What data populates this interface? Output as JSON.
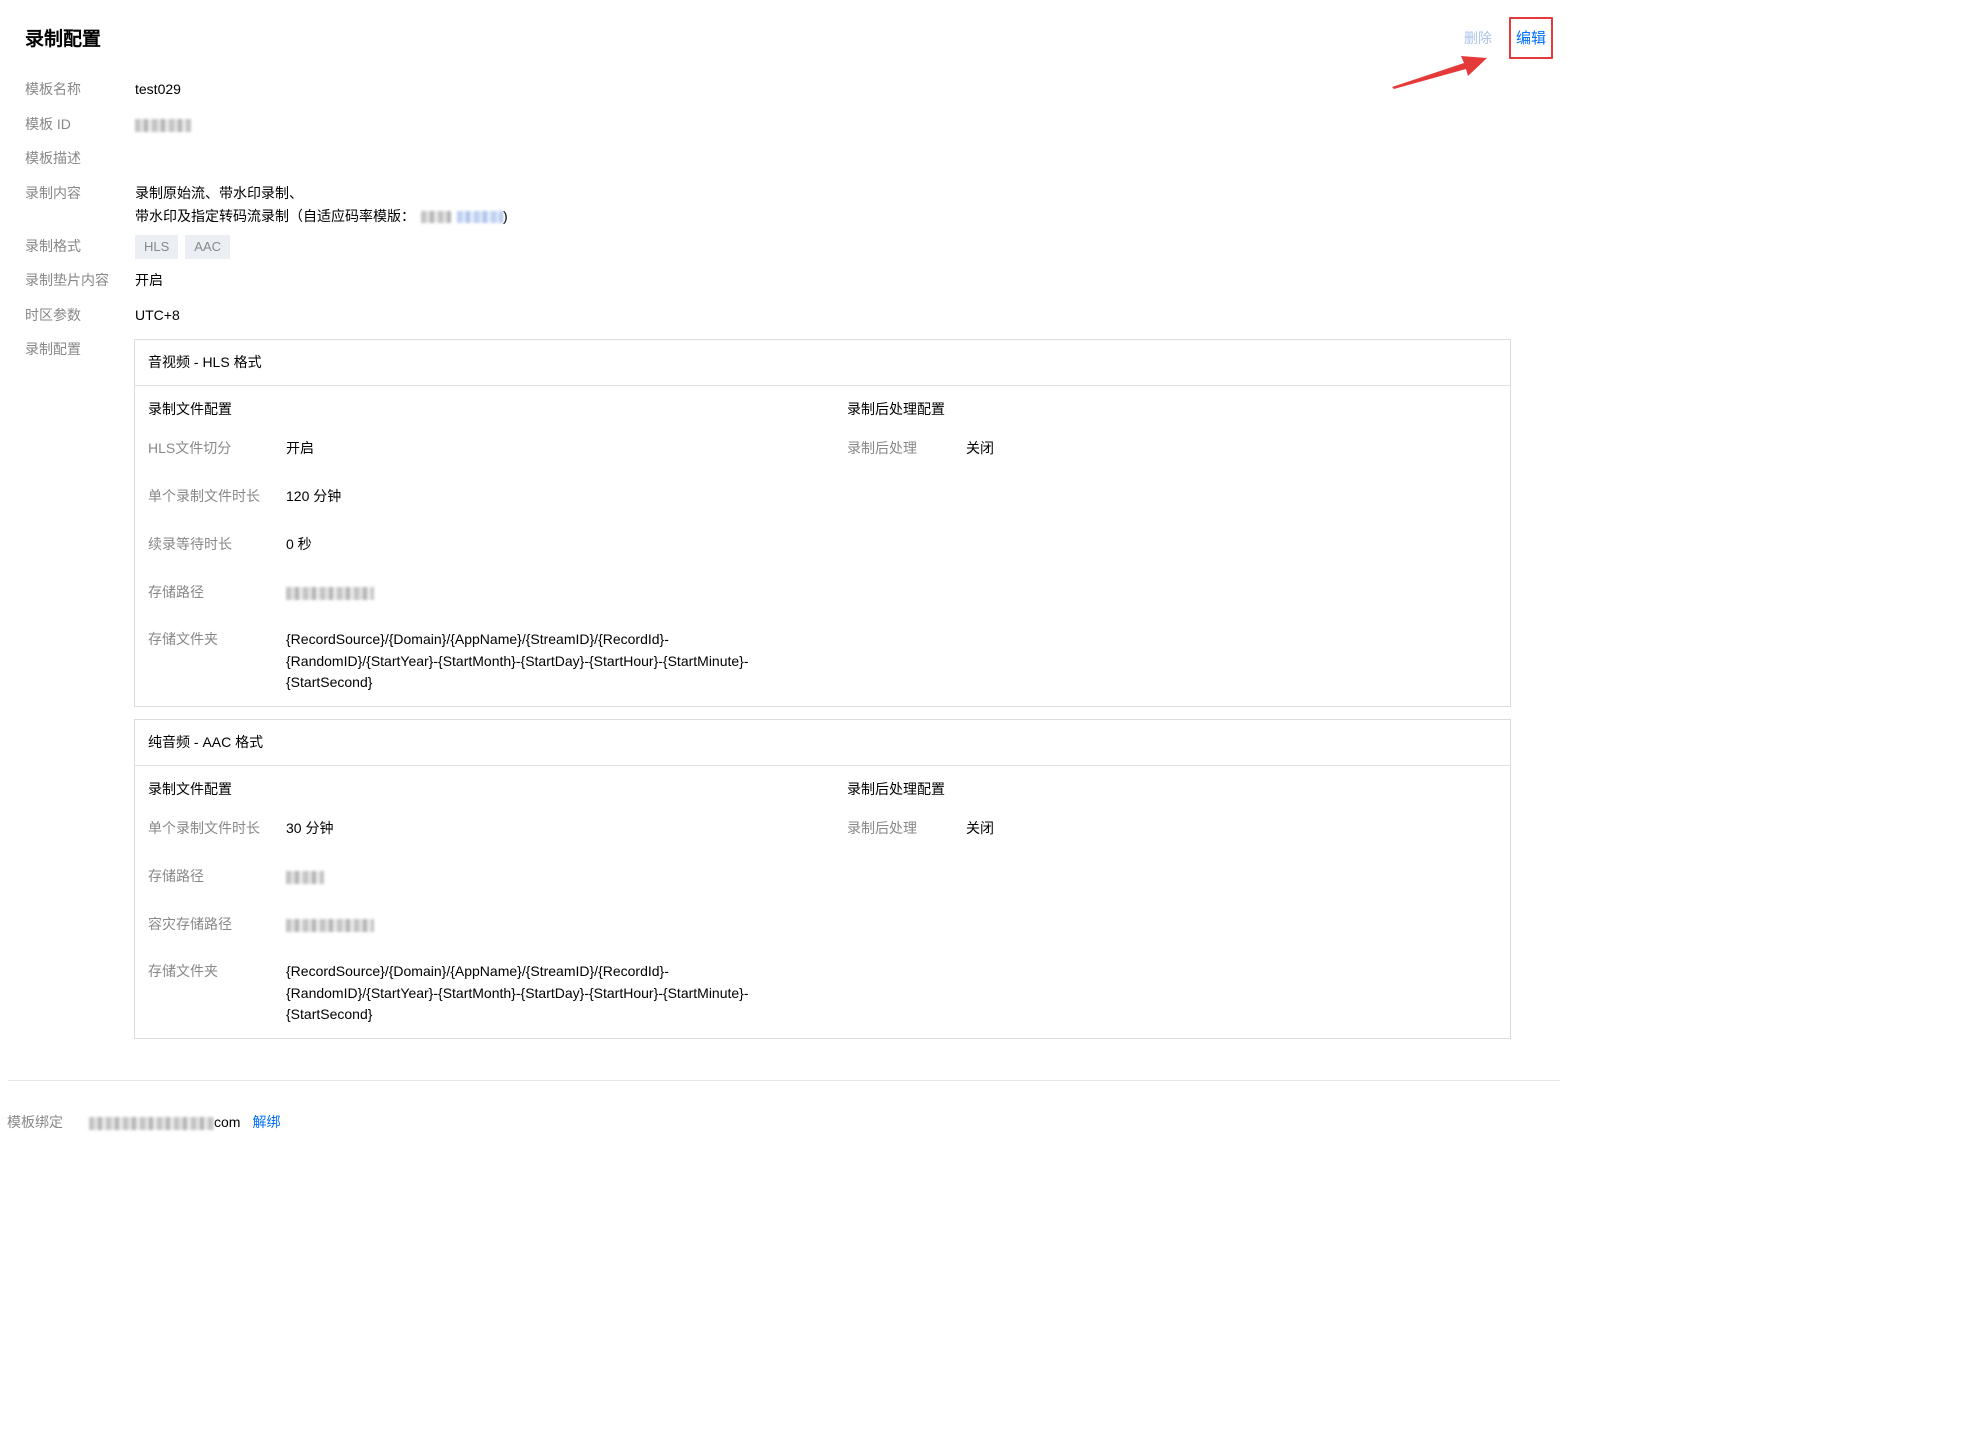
{
  "page": {
    "title": "录制配置"
  },
  "actions": {
    "delete_label": "删除",
    "edit_label": "编辑"
  },
  "info": {
    "name": {
      "label": "模板名称",
      "value": "test029"
    },
    "id": {
      "label": "模板 ID"
    },
    "desc": {
      "label": "模板描述",
      "value": ""
    },
    "content": {
      "label": "录制内容",
      "line1": "录制原始流、带水印录制、",
      "line2_prefix": "带水印及指定转码流录制（自适应码率模版：",
      "line2_suffix": ")"
    },
    "format": {
      "label": "录制格式",
      "tags": [
        "HLS",
        "AAC"
      ]
    },
    "pad": {
      "label": "录制垫片内容",
      "value": "开启"
    },
    "tz": {
      "label": "时区参数",
      "value": "UTC+8"
    },
    "config": {
      "label": "录制配置"
    }
  },
  "hls_box": {
    "title": "音视频 - HLS 格式",
    "file_config_title": "录制文件配置",
    "post_config_title": "录制后处理配置",
    "split": {
      "label": "HLS文件切分",
      "value": "开启"
    },
    "duration": {
      "label": "单个录制文件时长",
      "value": "120 分钟"
    },
    "wait": {
      "label": "续录等待时长",
      "value": "0 秒"
    },
    "path": {
      "label": "存储路径"
    },
    "folder": {
      "label": "存储文件夹",
      "line1": "{RecordSource}/{Domain}/{AppName}/{StreamID}/{RecordId}-",
      "line2": "{RandomID}/{StartYear}-{StartMonth}-{StartDay}-{StartHour}-{StartMinute}-",
      "line3": "{StartSecond}"
    },
    "post": {
      "label": "录制后处理",
      "value": "关闭"
    }
  },
  "aac_box": {
    "title": "纯音频 - AAC 格式",
    "file_config_title": "录制文件配置",
    "post_config_title": "录制后处理配置",
    "duration": {
      "label": "单个录制文件时长",
      "value": "30 分钟"
    },
    "path": {
      "label": "存储路径"
    },
    "backup_path": {
      "label": "容灾存储路径"
    },
    "folder": {
      "label": "存储文件夹",
      "line1": "{RecordSource}/{Domain}/{AppName}/{StreamID}/{RecordId}-",
      "line2": "{RandomID}/{StartYear}-{StartMonth}-{StartDay}-{StartHour}-{StartMinute}-",
      "line3": "{StartSecond}"
    },
    "post": {
      "label": "录制后处理",
      "value": "关闭"
    }
  },
  "binding": {
    "label": "模板绑定",
    "domain_suffix": "com",
    "unbind_label": "解绑"
  },
  "colors": {
    "link": "#006eff",
    "label": "#888888",
    "highlight": "#e53a3a",
    "disabled_link": "#a7c3ea"
  }
}
